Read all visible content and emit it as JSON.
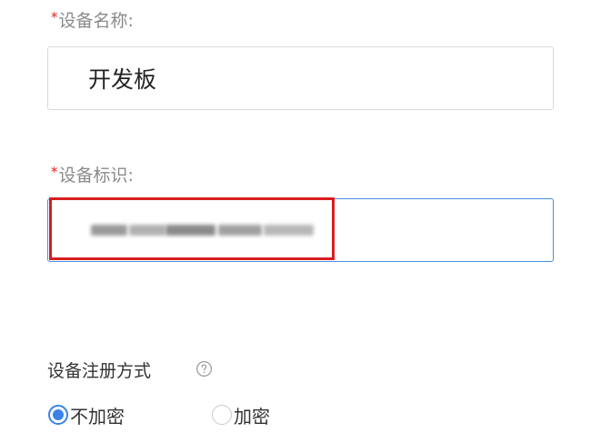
{
  "device_name": {
    "required_mark": "*",
    "label": "设备名称:",
    "value": "开发板"
  },
  "device_id": {
    "required_mark": "*",
    "label": "设备标识:",
    "value_state": "blurred"
  },
  "registration": {
    "title": "设备注册方式",
    "help_icon": "question-circle-icon",
    "options": [
      {
        "label": "不加密",
        "checked": true
      },
      {
        "label": "加密",
        "checked": false
      }
    ]
  },
  "colors": {
    "required": "#e0201c",
    "focus_border": "#4a90e2",
    "highlight": "#d81e1e",
    "radio_checked": "#3a82e6"
  }
}
